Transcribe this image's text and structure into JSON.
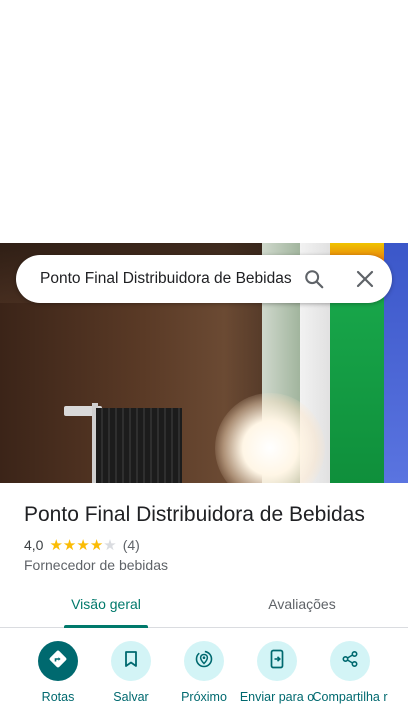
{
  "search": {
    "query": "Ponto Final Distribuidora de Bebidas"
  },
  "place": {
    "name": "Ponto Final Distribuidora de Bebidas",
    "rating": "4,0",
    "rating_value": 4,
    "rating_max": 5,
    "review_count": "(4)",
    "category": "Fornecedor de bebidas"
  },
  "tabs": [
    {
      "label": "Visão geral",
      "selected": true
    },
    {
      "label": "Avaliações",
      "selected": false
    }
  ],
  "actions": [
    {
      "label": "Rotas",
      "icon": "directions-icon"
    },
    {
      "label": "Salvar",
      "icon": "bookmark-icon"
    },
    {
      "label": "Próximo",
      "icon": "nearby-icon"
    },
    {
      "label": "Enviar para o",
      "icon": "send-to-phone-icon"
    },
    {
      "label": "Compartilha r",
      "icon": "share-icon"
    }
  ],
  "colors": {
    "accent": "#00796b",
    "action_primary": "#00696f",
    "action_bg": "#d3f4f6",
    "star": "#fbbc04",
    "star_empty": "#dadce0"
  }
}
